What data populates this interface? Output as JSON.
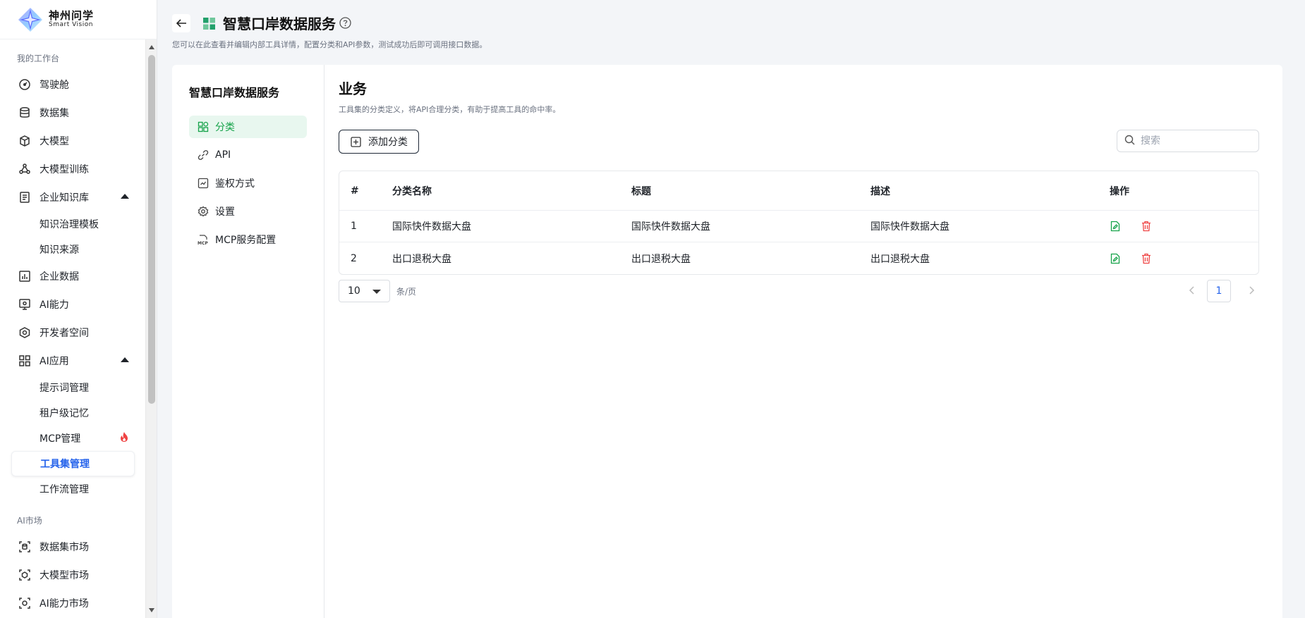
{
  "brand": {
    "name_cn": "神州问学",
    "name_en": "Smart Vision"
  },
  "sidebar": {
    "group1_label": "我的工作台",
    "items": [
      {
        "label": "驾驶舱",
        "icon": "dashboard-icon"
      },
      {
        "label": "数据集",
        "icon": "database-icon"
      },
      {
        "label": "大模型",
        "icon": "cube-icon"
      },
      {
        "label": "大模型训练",
        "icon": "training-icon"
      },
      {
        "label": "企业知识库",
        "icon": "knowledge-icon"
      },
      {
        "label": "企业数据",
        "icon": "bar-chart-icon"
      },
      {
        "label": "AI能力",
        "icon": "ai-monitor-icon"
      },
      {
        "label": "开发者空间",
        "icon": "developer-icon"
      },
      {
        "label": "AI应用",
        "icon": "apps-grid-icon"
      }
    ],
    "knowledge_sub": [
      "知识治理模板",
      "知识来源"
    ],
    "ai_app_sub": [
      "提示词管理",
      "租户级记忆",
      "MCP管理",
      "工具集管理",
      "工作流管理"
    ],
    "active_sub": "工具集管理",
    "group2_label": "AI市场",
    "market_items": [
      {
        "label": "数据集市场"
      },
      {
        "label": "大模型市场"
      },
      {
        "label": "AI能力市场"
      }
    ]
  },
  "header": {
    "title": "智慧口岸数据服务",
    "subtitle": "您可以在此查看并编辑内部工具详情，配置分类和API参数，测试成功后即可调用接口数据。"
  },
  "tool_nav": {
    "tool_name": "智慧口岸数据服务",
    "items": [
      "分类",
      "API",
      "鉴权方式",
      "设置",
      "MCP服务配置"
    ],
    "active": "分类"
  },
  "section": {
    "title": "业务",
    "desc": "工具集的分类定义，将API合理分类，有助于提高工具的命中率。",
    "add_button": "添加分类",
    "search_placeholder": "搜索"
  },
  "table": {
    "headers": [
      "#",
      "分类名称",
      "标题",
      "描述",
      "操作"
    ],
    "rows": [
      {
        "idx": "1",
        "name": "国际快件数据大盘",
        "title": "国际快件数据大盘",
        "desc": "国际快件数据大盘"
      },
      {
        "idx": "2",
        "name": "出口退税大盘",
        "title": "出口退税大盘",
        "desc": "出口退税大盘"
      }
    ]
  },
  "pagination": {
    "page_size": "10",
    "per_page_label": "条/页",
    "current_page": "1"
  },
  "colors": {
    "accent_green": "#16a34a",
    "active_blue": "#2563eb",
    "danger_red": "#ef4444"
  }
}
